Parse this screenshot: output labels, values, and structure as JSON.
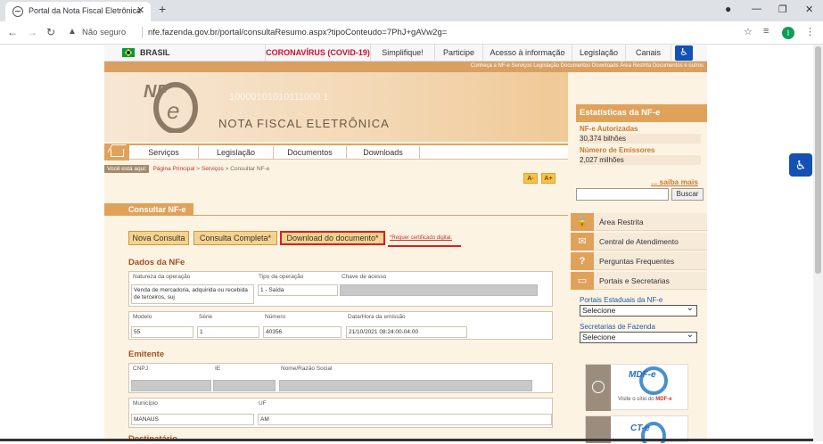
{
  "browser": {
    "tab_title": "Portal da Nota Fiscal Eletrônica",
    "security_label": "Não seguro",
    "url": "nfe.fazenda.gov.br/portal/consultaResumo.aspx?tipoConteudo=7PhJ+gAVw2g=",
    "avatar_letter": "I"
  },
  "gov_bar": {
    "brand": "BRASIL",
    "items": [
      "CORONAVÍRUS (COVID-19)",
      "Simplifique!",
      "Participe",
      "Acesso à informação",
      "Legislação",
      "Canais"
    ]
  },
  "top_links": "Conheça a NF-e  Serviços  Legislação  Documentos  Downloads  Área Restrita  Documentos e outros",
  "banner": {
    "logo_text": "NF-e",
    "title": "NOTA FISCAL ELETRÔNICA",
    "bits": "10000101010111000 1"
  },
  "menu": [
    "Serviços",
    "Legislação",
    "Documentos",
    "Downloads"
  ],
  "breadcrumb": {
    "label": "Você está aqui:",
    "path_a": "Página Principal",
    "path_b": "Serviços",
    "path_c": "Consultar NF-e"
  },
  "font_buttons": [
    "A-",
    "A+"
  ],
  "section_title": "Consultar NF-e",
  "actions": {
    "new": "Nova Consulta",
    "full": "Consulta Completa*",
    "download": "Download do documento*",
    "cert_note": "*Requer certificado digital."
  },
  "dados": {
    "heading": "Dados da NFe",
    "natureza_label": "Natureza da operação",
    "natureza_value": "Venda de mercadoria, adquirida ou recebida de terceiros, suj",
    "tipo_label": "Tipo da operação",
    "tipo_value": "1 - Saída",
    "chave_label": "Chave de acesso",
    "modelo_label": "Modelo",
    "modelo_value": "55",
    "serie_label": "Série",
    "serie_value": "1",
    "numero_label": "Número",
    "numero_value": "40356",
    "data_label": "Data/Hora da emissão",
    "data_value": "21/10/2021 08:24:00-04:00"
  },
  "emitente": {
    "heading": "Emitente",
    "cnpj_label": "CNPJ",
    "ie_label": "IE",
    "nome_label": "Nome/Razão Social",
    "municipio_label": "Município",
    "municipio_value": "MANAUS",
    "uf_label": "UF",
    "uf_value": "AM"
  },
  "next_heading": "Destinatário",
  "stats": {
    "title": "Estatísticas da NF-e",
    "autorizadas_label": "NF-e Autorizadas",
    "autorizadas_value": "30,374 bilhões",
    "emissores_label": "Número de Emissores",
    "emissores_value": "2,027 milhões",
    "more": "... saiba mais"
  },
  "search_button": "Buscar",
  "side_links": [
    "Área Restrita",
    "Central de Atendimento",
    "Perguntas Frequentes",
    "Portais e Secretarias"
  ],
  "side_selects": [
    {
      "label": "Portais Estaduais da NF-e",
      "value": "Selecione"
    },
    {
      "label": "Secretarias de Fazenda",
      "value": "Selecione"
    }
  ],
  "promo": {
    "caption_prefix": "Visite o sítio do ",
    "caption_brand": "MDF-e",
    "logo1": "MDF-e",
    "logo2": "CT-e"
  },
  "colors": {
    "accent": "#e0a25a",
    "highlight": "#d62020",
    "link": "#c47a2e"
  }
}
